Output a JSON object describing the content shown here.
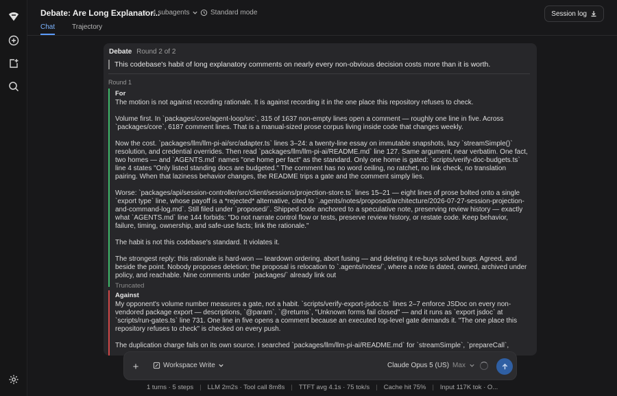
{
  "header": {
    "title": "Debate: Are Long Explanator...",
    "separator": "/",
    "subagents": "4 subagents",
    "mode": "Standard mode",
    "session_log": "Session log",
    "tabs": [
      {
        "label": "Chat",
        "active": true
      },
      {
        "label": "Trajectory",
        "active": false
      }
    ]
  },
  "sidebar": {
    "icons": [
      "logo-icon",
      "new-chat-icon",
      "new-task-icon",
      "search-icon",
      "settings-icon"
    ]
  },
  "debate": {
    "label": "Debate",
    "round_info": "Round 2 of 2",
    "topic": "This codebase's habit of long explanatory comments on nearly every non-obvious decision costs more than it is worth.",
    "round_label": "Round 1",
    "for": {
      "label": "For",
      "paragraphs": [
        "The motion is not against recording rationale. It is against recording it in the one place this repository refuses to check.",
        "Volume first. In `packages/core/agent-loop/src`, 315 of 1637 non-empty lines open a comment — roughly one line in five. Across `packages/core`, 6187 comment lines. That is a manual-sized prose corpus living inside code that changes weekly.",
        "Now the cost. `packages/llm/llm-pi-ai/src/adapter.ts` lines 3–24: a twenty-line essay on immutable snapshots, lazy `streamSimple()` resolution, and credential overrides. Then read `packages/llm/llm-pi-ai/README.md` line 127. Same argument, near verbatim. One fact, two homes — and `AGENTS.md` names \"one home per fact\" as the standard. Only one home is gated: `scripts/verify-doc-budgets.ts` line 4 states \"Only listed standing docs are budgeted.\" The comment has no word ceiling, no ratchet, no link check, no translation pairing. When that laziness behavior changes, the README trips a gate and the comment simply lies.",
        "Worse: `packages/api/session-controller/src/client/sessions/projection-store.ts` lines 15–21 — eight lines of prose bolted onto a single `export type` line, whose payoff is a *rejected* alternative, cited to `.agents/notes/proposed/architecture/2026-07-27-session-projection-and-command-log.md`. Still filed under `proposed/`. Shipped code anchored to a speculative note, preserving review history — exactly what `AGENTS.md` line 144 forbids: \"Do not narrate control flow or tests, preserve review history, or restate code. Keep behavior, failure, timing, ownership, and safe-use facts; link the rationale.\"",
        "The habit is not this codebase's standard. It violates it.",
        "The strongest reply: this rationale is hard-won — teardown ordering, abort fusing — and deleting it re-buys solved bugs. Agreed, and beside the point. Nobody proposes deletion; the proposal is relocation to `.agents/notes/`, where a note is dated, owned, archived under policy, and reachable. Nine comments under `packages/` already link out"
      ],
      "truncated": "Truncated"
    },
    "against": {
      "label": "Against",
      "paragraphs": [
        "My opponent's volume number measures a gate, not a habit. `scripts/verify-export-jsdoc.ts` lines 2–7 enforce JSDoc on every non-vendored package export — descriptions, `@param`, `@returns`, \"Unknown forms fail closed\" — and it runs as `export jsdoc` at `scripts/run-gates.ts` line 731. One line in five opens a comment because an executed top-level gate demands it. \"The one place this repository refuses to check\" is checked on every push.",
        "The duplication charge fails on its own source. I searched `packages/llm/llm-pi-ai/README.md` for `streamSimple`, `prepareCall`,"
      ]
    }
  },
  "composer": {
    "add_label": "+",
    "workspace_mode": "Workspace Write",
    "model": "Claude Opus 5 (US)",
    "effort": "Max"
  },
  "status_bar": {
    "items": [
      "1 turns · 5 steps",
      "LLM 2m2s · Tool call 8m8s",
      "TTFT avg 4.1s · 75 tok/s",
      "Cache hit 75%",
      "Input 117K tok · O..."
    ]
  },
  "colors": {
    "for_accent": "#3fb86a",
    "against_accent": "#d04848",
    "active_tab": "#7db4ff",
    "send_button": "#2f5fa3"
  }
}
